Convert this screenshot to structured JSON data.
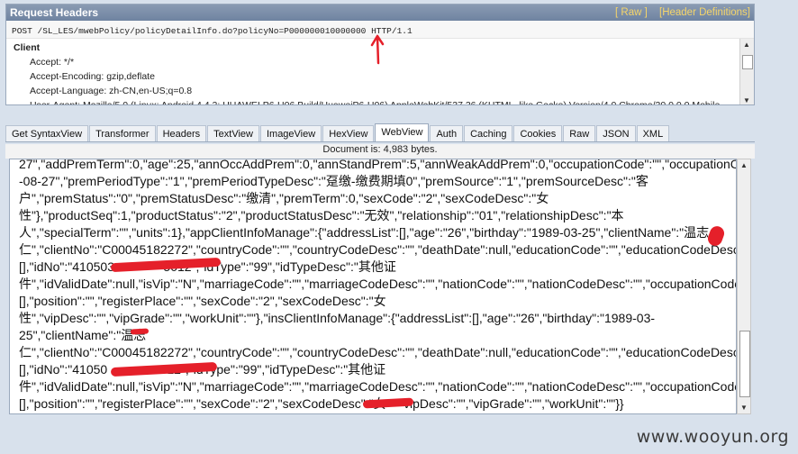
{
  "request_panel": {
    "title": "Request Headers",
    "links": [
      "[ Raw ]",
      "[Header Definitions]"
    ],
    "request_line": "POST /SL_LES/mwebPolicy/policyDetailInfo.do?policyNo=P000000010000000 HTTP/1.1",
    "group": "Client",
    "headers": [
      "Accept: */*",
      "Accept-Encoding: gzip,deflate",
      "Accept-Language: zh-CN,en-US;q=0.8",
      "User-Agent: Mozilla/5.0 (Linux; Android 4.4.2; HUAWEI P6-U06 Build/HuaweiP6-U06) AppleWebKit/537.36 (KHTML, like Gecko) Version/4.0 Chrome/30.0.0.0 Mobile"
    ]
  },
  "tabs": [
    {
      "label": "Get SyntaxView",
      "active": false
    },
    {
      "label": "Transformer",
      "active": false
    },
    {
      "label": "Headers",
      "active": false
    },
    {
      "label": "TextView",
      "active": false
    },
    {
      "label": "ImageView",
      "active": false
    },
    {
      "label": "HexView",
      "active": false
    },
    {
      "label": "WebView",
      "active": true
    },
    {
      "label": "Auth",
      "active": false
    },
    {
      "label": "Caching",
      "active": false
    },
    {
      "label": "Cookies",
      "active": false
    },
    {
      "label": "Raw",
      "active": false
    },
    {
      "label": "JSON",
      "active": false
    },
    {
      "label": "XML",
      "active": false
    }
  ],
  "doc_status": "Document is: 4,983 bytes.",
  "content_lines": [
    "27\",\"addPremTerm\":0,\"age\":25,\"annOccAddPrem\":0,\"annStandPrem\":5,\"annWeakAddPrem\":0,\"occupationCode\":\"\",\"occupationCo",
    "-08-27\",\"premPeriodType\":\"1\",\"premPeriodTypeDesc\":\"趸缴-缴费期填0\",\"premSource\":\"1\",\"premSourceDesc\":\"客",
    "户\",\"premStatus\":\"0\",\"premStatusDesc\":\"缴清\",\"premTerm\":0,\"sexCode\":\"2\",\"sexCodeDesc\":\"女",
    "性\"},\"productSeq\":1,\"productStatus\":\"2\",\"productStatusDesc\":\"无效\",\"relationship\":\"01\",\"relationshipDesc\":\"本",
    "人\",\"specialTerm\":\"\",\"units\":1},\"appClientInfoManage\":{\"addressList\":[],\"age\":\"26\",\"birthday\":\"1989-03-25\",\"clientName\":\"温志",
    "仁\",\"clientNo\":\"C00045182272\",\"countryCode\":\"\",\"countryCodeDesc\":\"\",\"deathDate\":null,\"educationCode\":\"\",\"educationCodeDesc",
    "[],\"idNo\":\"410503              5012\",\"idType\":\"99\",\"idTypeDesc\":\"其他证",
    "件\",\"idValidDate\":null,\"isVip\":\"N\",\"marriageCode\":\"\",\"marriageCodeDesc\":\"\",\"nationCode\":\"\",\"nationCodeDesc\":\"\",\"occupationCode",
    "[],\"position\":\"\",\"registerPlace\":\"\",\"sexCode\":\"2\",\"sexCodeDesc\":\"女",
    "性\",\"vipDesc\":\"\",\"vipGrade\":\"\",\"workUnit\":\"\"},\"insClientInfoManage\":{\"addressList\":[],\"age\":\"26\",\"birthday\":\"1989-03-",
    "25\",\"clientName\":\"温志",
    "仁\",\"clientNo\":\"C00045182272\",\"countryCode\":\"\",\"countryCodeDesc\":\"\",\"deathDate\":null,\"educationCode\":\"\",\"educationCodeDesc",
    "[],\"idNo\":\"41050               012\",\"idType\":\"99\",\"idTypeDesc\":\"其他证",
    "件\",\"idValidDate\":null,\"isVip\":\"N\",\"marriageCode\":\"\",\"marriageCodeDesc\":\"\",\"nationCode\":\"\",\"nationCodeDesc\":\"\",\"occupationCode",
    "[],\"position\":\"\",\"registerPlace\":\"\",\"sexCode\":\"2\",\"sexCodeDesc\":\"女     vipDesc\":\"\",\"vipGrade\":\"\",\"workUnit\":\"\"}}"
  ],
  "watermark": "www.wooyun.org",
  "colors": {
    "header_bar": "#7a8ca8",
    "link_yellow": "#f5d56a",
    "redaction": "#e5202a"
  }
}
